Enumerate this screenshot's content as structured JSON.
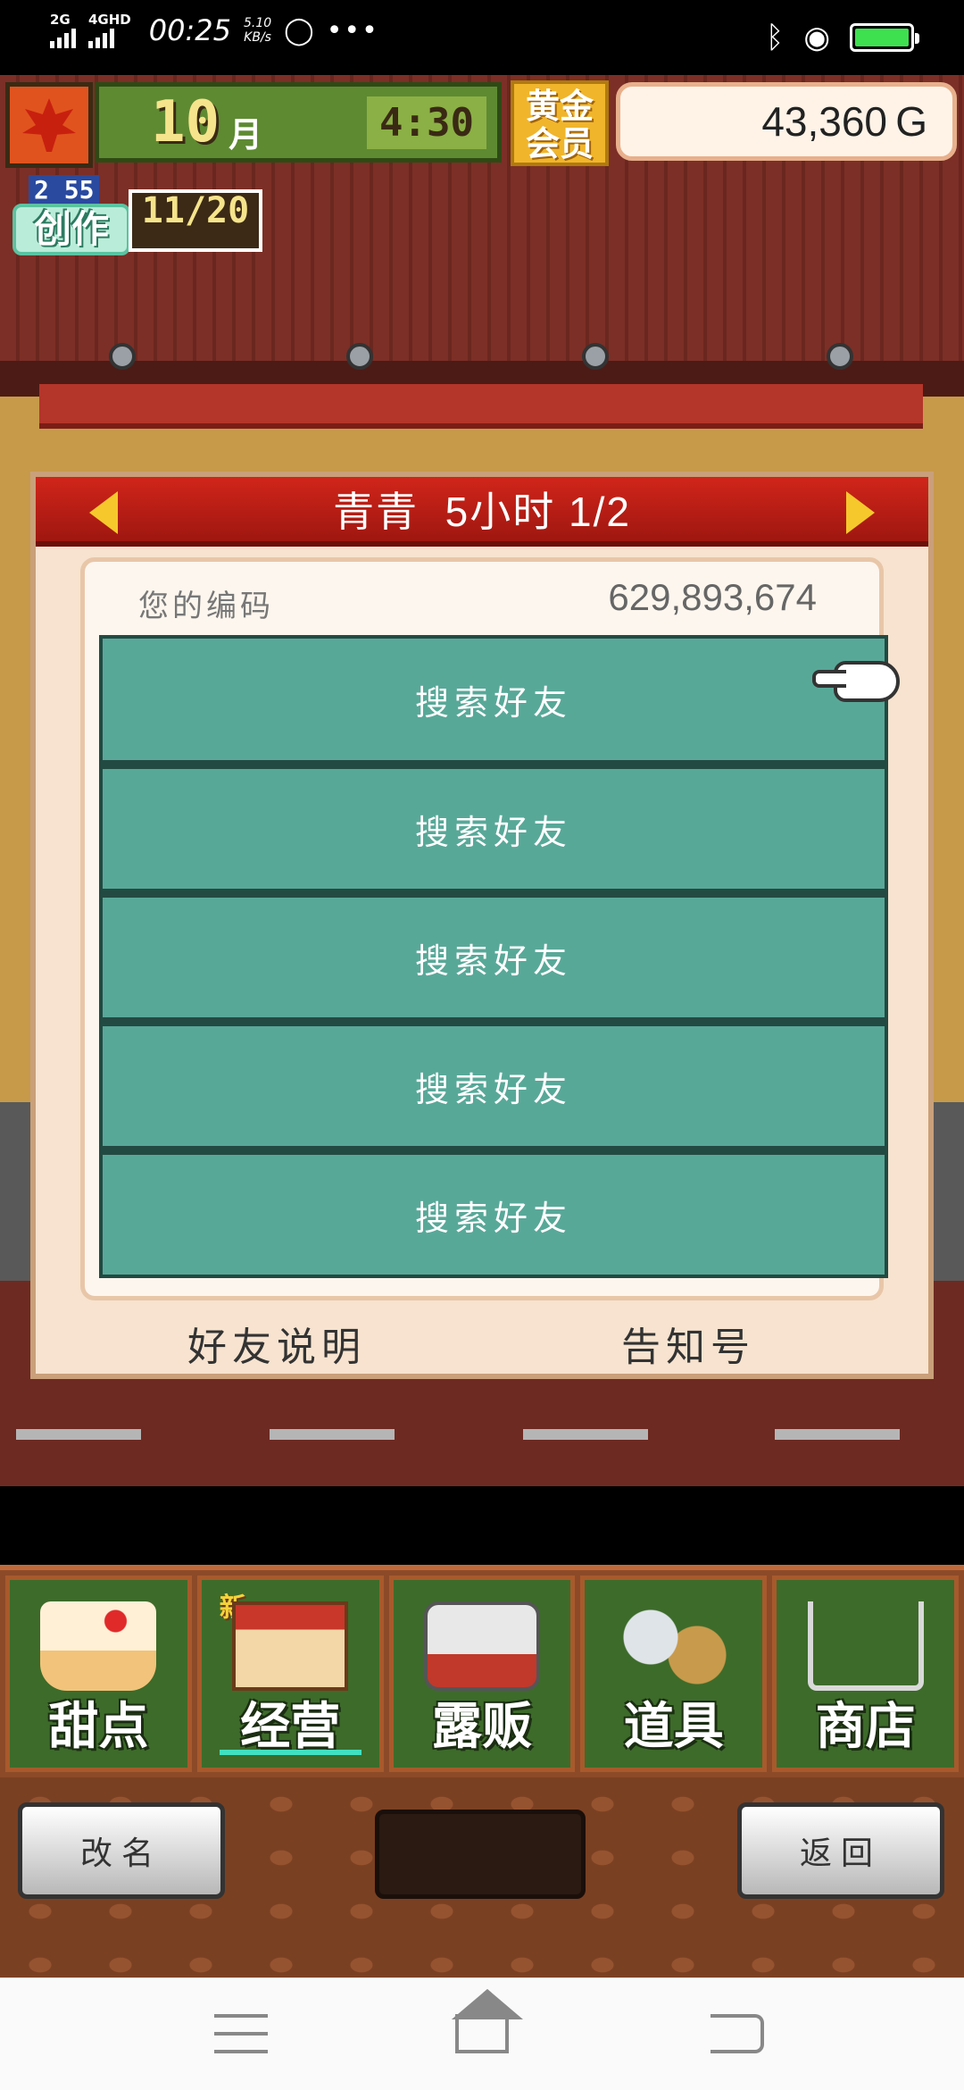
{
  "status_bar": {
    "network1": "2G",
    "network2": "4GHD",
    "time": "00:25",
    "speed_value": "5.10",
    "speed_unit": "KB/s",
    "more": "•••",
    "battery_color": "#3ee04f"
  },
  "hud": {
    "month_number": "10",
    "month_label": "月",
    "clock": "4:30",
    "vip_label": "黄金会员",
    "gold": "43,360 G",
    "create_level": "2 55",
    "create_label": "创作",
    "create_count": "11/20",
    "icon": "maple-leaf-icon"
  },
  "dialog": {
    "title": "青青  5小时 1/2",
    "code_label": "您的编码",
    "code_value": "629,893,674",
    "slots": [
      {
        "label": "搜索好友"
      },
      {
        "label": "搜索好友"
      },
      {
        "label": "搜索好友"
      },
      {
        "label": "搜索好友"
      },
      {
        "label": "搜索好友"
      }
    ],
    "footer_left": "好友说明",
    "footer_right": "告知号",
    "header_color": "#c41f16",
    "slot_color": "#58a898"
  },
  "menu": {
    "items": [
      {
        "label": "甜点",
        "icon": "cake-icon"
      },
      {
        "label": "经营",
        "icon": "shop-icon",
        "tag": "新"
      },
      {
        "label": "露贩",
        "icon": "food-truck-icon"
      },
      {
        "label": "道具",
        "icon": "tools-icon"
      },
      {
        "label": "商店",
        "icon": "shopping-cart-icon"
      }
    ]
  },
  "bottom": {
    "rename": "改名",
    "back": "返回"
  },
  "nav": {
    "menu_icon": "menu-icon",
    "home_icon": "home-icon",
    "back_icon": "back-icon"
  }
}
